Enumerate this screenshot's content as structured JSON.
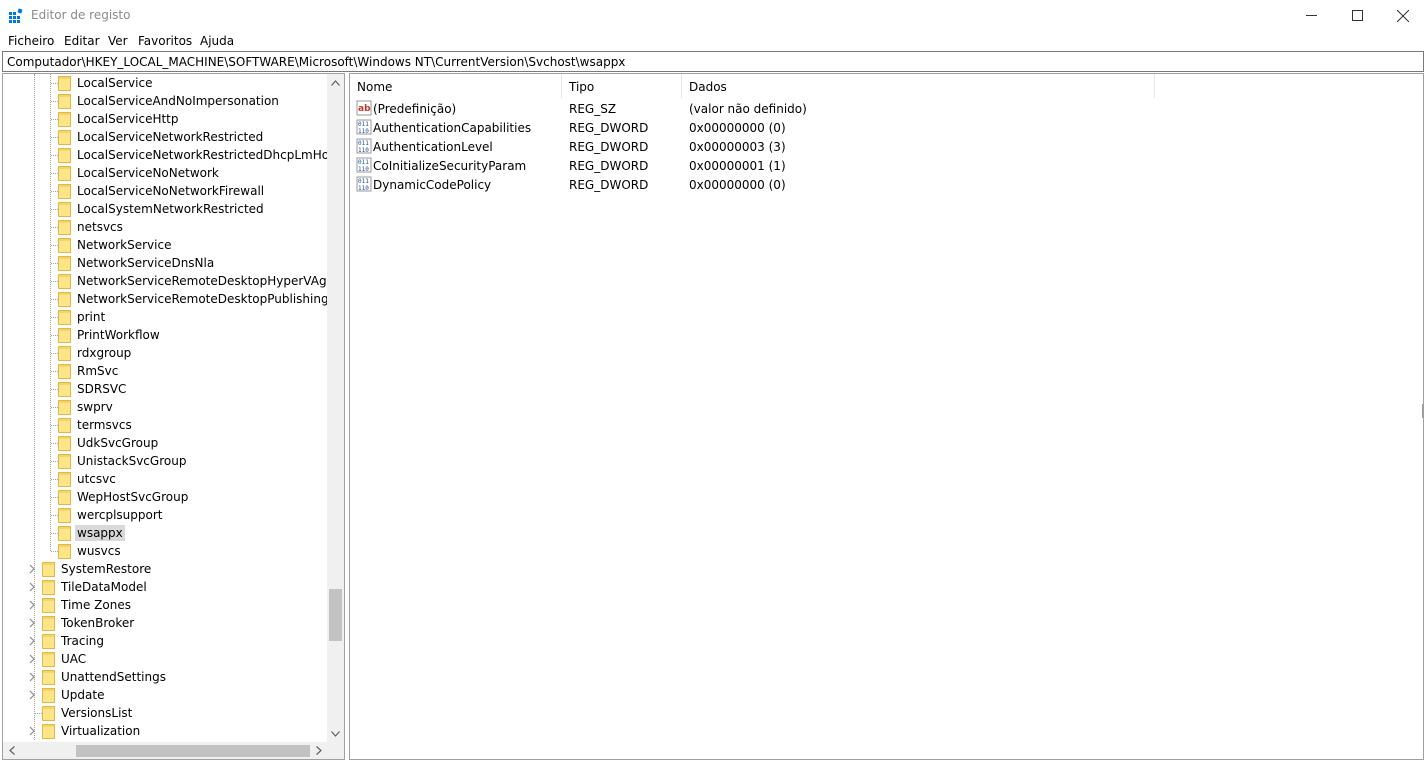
{
  "window": {
    "title": "Editor de registo",
    "accent_color": "#0078d7"
  },
  "menu": [
    "Ficheiro",
    "Editar",
    "Ver",
    "Favoritos",
    "Ajuda"
  ],
  "address": "Computador\\HKEY_LOCAL_MACHINE\\SOFTWARE\\Microsoft\\Windows NT\\CurrentVersion\\Svchost\\wsappx",
  "tree": {
    "children": [
      "LocalService",
      "LocalServiceAndNoImpersonation",
      "LocalServiceHttp",
      "LocalServiceNetworkRestricted",
      "LocalServiceNetworkRestrictedDhcpLmHosts",
      "LocalServiceNoNetwork",
      "LocalServiceNoNetworkFirewall",
      "LocalSystemNetworkRestricted",
      "netsvcs",
      "NetworkService",
      "NetworkServiceDnsNla",
      "NetworkServiceRemoteDesktopHyperVAgent",
      "NetworkServiceRemoteDesktopPublishing",
      "print",
      "PrintWorkflow",
      "rdxgroup",
      "RmSvc",
      "SDRSVC",
      "swprv",
      "termsvcs",
      "UdkSvcGroup",
      "UnistackSvcGroup",
      "utcsvc",
      "WepHostSvcGroup",
      "wercplsupport",
      "wsappx",
      "wusvcs"
    ],
    "selected": "wsappx",
    "siblings": [
      {
        "label": "SystemRestore",
        "expandable": true
      },
      {
        "label": "TileDataModel",
        "expandable": true
      },
      {
        "label": "Time Zones",
        "expandable": true
      },
      {
        "label": "TokenBroker",
        "expandable": true
      },
      {
        "label": "Tracing",
        "expandable": true
      },
      {
        "label": "UAC",
        "expandable": true
      },
      {
        "label": "UnattendSettings",
        "expandable": true
      },
      {
        "label": "Update",
        "expandable": true
      },
      {
        "label": "VersionsList",
        "expandable": false
      },
      {
        "label": "Virtualization",
        "expandable": true
      }
    ]
  },
  "list": {
    "columns": [
      "Nome",
      "Tipo",
      "Dados"
    ],
    "rows": [
      {
        "icon": "string-value-icon",
        "name": "(Predefinição)",
        "type": "REG_SZ",
        "data": "(valor não definido)"
      },
      {
        "icon": "binary-value-icon",
        "name": "AuthenticationCapabilities",
        "type": "REG_DWORD",
        "data": "0x00000000 (0)"
      },
      {
        "icon": "binary-value-icon",
        "name": "AuthenticationLevel",
        "type": "REG_DWORD",
        "data": "0x00000003 (3)"
      },
      {
        "icon": "binary-value-icon",
        "name": "CoInitializeSecurityParam",
        "type": "REG_DWORD",
        "data": "0x00000001 (1)"
      },
      {
        "icon": "binary-value-icon",
        "name": "DynamicCodePolicy",
        "type": "REG_DWORD",
        "data": "0x00000000 (0)"
      }
    ]
  }
}
